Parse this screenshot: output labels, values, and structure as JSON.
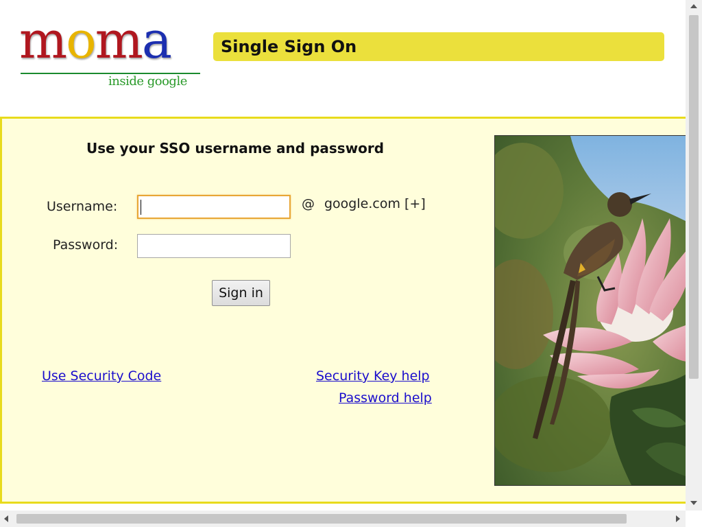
{
  "logo": {
    "word_letters": [
      "m",
      "o",
      "m",
      "a"
    ],
    "word_colors": [
      "#b0171f",
      "#e8b400",
      "#b0171f",
      "#1c2fb0"
    ],
    "subtitle": "inside google"
  },
  "header": {
    "title": "Single Sign On",
    "title_bg": "#ebe03c"
  },
  "login": {
    "heading": "Use your SSO username and password",
    "username_label": "Username:",
    "username_value": "",
    "password_label": "Password:",
    "password_value": "",
    "at_symbol": "@",
    "domain": "google.com [+]",
    "signin_label": "Sign in"
  },
  "links": {
    "security_code": "Use Security Code",
    "security_key_help": "Security Key help",
    "password_help": "Password help"
  },
  "colors": {
    "panel_bg": "#fffedb",
    "panel_border": "#e8db1c",
    "link": "#1a0dcc",
    "focus_ring": "#e8a636"
  },
  "photo": {
    "icon": "sunbird-on-protea-photo"
  }
}
